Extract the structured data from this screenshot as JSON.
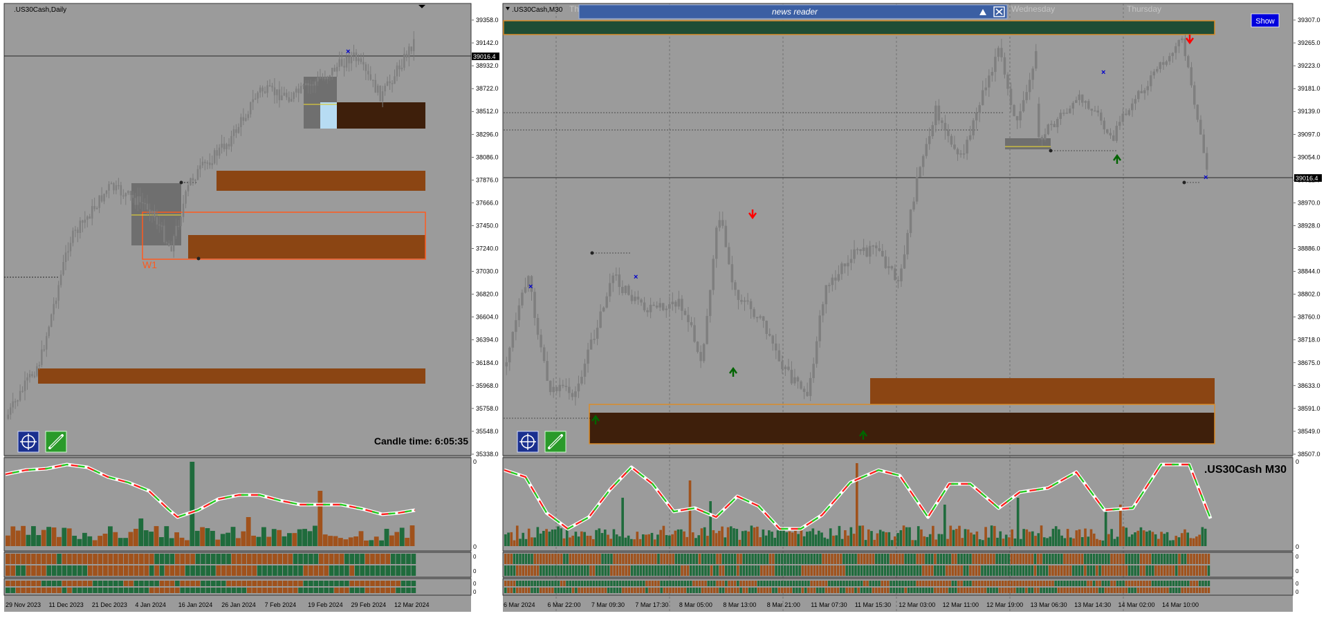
{
  "left_chart": {
    "symbol_label": ".US30Cash,Daily",
    "price_levels": [
      "39358.0",
      "39142.0",
      "38932.0",
      "38722.0",
      "38512.0",
      "38296.0",
      "38086.0",
      "37876.0",
      "37666.0",
      "37450.0",
      "37240.0",
      "37030.0",
      "36820.0",
      "36604.0",
      "36394.0",
      "36184.0",
      "35968.0",
      "35758.0",
      "35548.0",
      "35338.0"
    ],
    "current_price": "39016.4",
    "zone_label": "W1",
    "candle_time_label": "Candle time:  6:05:35",
    "date_labels": [
      "29 Nov 2023",
      "11 Dec 2023",
      "21 Dec 2023",
      "4 Jan 2024",
      "16 Jan 2024",
      "26 Jan 2024",
      "7 Feb 2024",
      "19 Feb 2024",
      "29 Feb 2024",
      "12 Mar 2024"
    ],
    "indicator_scale": [
      "0",
      "0"
    ],
    "sub_scale": [
      "0",
      "0",
      "0",
      "0"
    ]
  },
  "right_chart": {
    "symbol_label": ".US30Cash,M30",
    "overlay_label": ".US30Cash  M30",
    "day_labels": [
      "Thursday",
      "Wednesday",
      "Thursday"
    ],
    "price_levels": [
      "39307.0",
      "39265.0",
      "39223.0",
      "39181.0",
      "39139.0",
      "39097.0",
      "39054.0",
      "39012.0",
      "38970.0",
      "38928.0",
      "38886.0",
      "38844.0",
      "38802.0",
      "38760.0",
      "38718.0",
      "38675.0",
      "38633.0",
      "38591.0",
      "38549.0",
      "38507.0"
    ],
    "current_price": "39016.4",
    "date_labels": [
      "6 Mar 2024",
      "6 Mar 22:00",
      "7 Mar 09:30",
      "7 Mar 17:30",
      "8 Mar 05:00",
      "8 Mar 13:00",
      "8 Mar 21:00",
      "11 Mar 07:30",
      "11 Mar 15:30",
      "12 Mar 03:00",
      "12 Mar 11:00",
      "12 Mar 19:00",
      "13 Mar 06:30",
      "13 Mar 14:30",
      "14 Mar 02:00",
      "14 Mar 10:00"
    ],
    "indicator_scale": [
      "0",
      "0"
    ],
    "sub_scale": [
      "0",
      "0",
      "0",
      "0"
    ]
  },
  "news_reader": {
    "title": "news reader",
    "collapse_icon": "triangle-up-icon",
    "close_icon": "close-icon"
  },
  "show_button": {
    "label": "Show"
  },
  "toolbar_icons": [
    "crosshair-icon",
    "link-icon"
  ],
  "colors": {
    "bg": "#9b9b9b",
    "bull": "#1f6b3c",
    "bear": "#a0521c",
    "zone_orange": "#8b4513",
    "zone_dark": "#3e1f0b",
    "accent_blue": "#0000cc"
  }
}
